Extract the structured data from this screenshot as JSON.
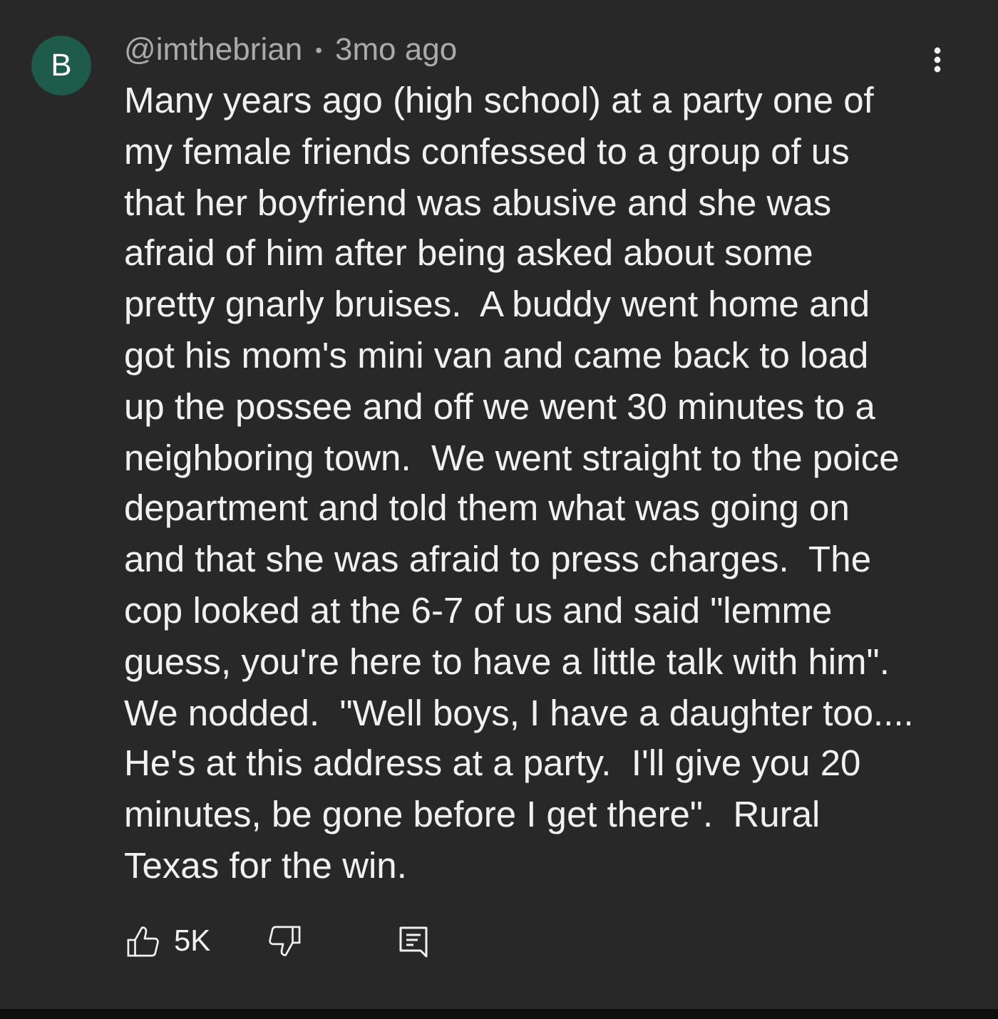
{
  "comment": {
    "avatar_initial": "B",
    "author": "@imthebrian",
    "separator": "•",
    "time": "3mo ago",
    "body": "Many years ago (high school) at a party one of\nmy female friends confessed to a group of us\nthat her boyfriend was abusive and she was\nafraid of him after being asked about some\npretty gnarly bruises.  A buddy went home and\ngot his mom's mini van and came back to load\nup the possee and off we went 30 minutes to a\nneighboring town.  We went straight to the poice\ndepartment and told them what was going on\nand that she was afraid to press charges.  The\ncop looked at the 6-7 of us and said \"lemme\nguess, you're here to have a little talk with him\".\nWe nodded.  \"Well boys, I have a daughter too....\nHe's at this address at a party.  I'll give you 20\nminutes, be gone before I get there\".  Rural\nTexas for the win.",
    "likes": "5K"
  }
}
